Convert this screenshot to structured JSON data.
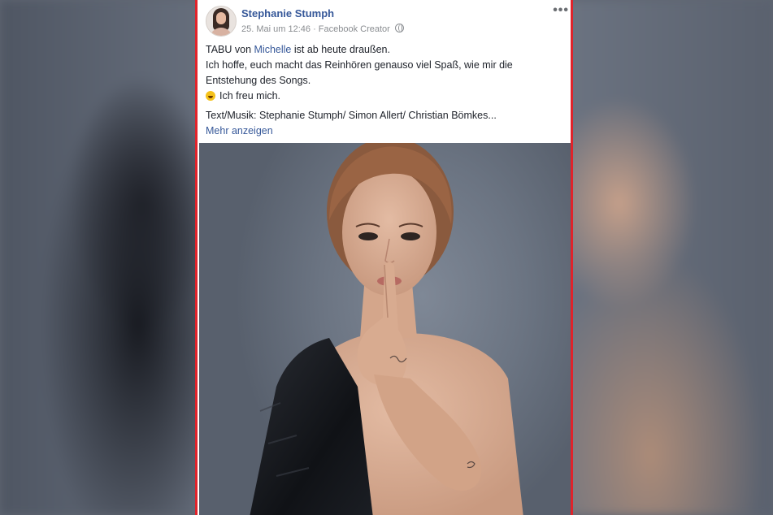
{
  "post": {
    "author": "Stephanie Stumph",
    "date": "25. Mai um 12:46",
    "separator": "·",
    "role": "Facebook Creator",
    "more_label": "•••",
    "text": {
      "line1_prefix": "TABU von ",
      "line1_link": "Michelle",
      "line1_suffix": " ist ab heute draußen.",
      "line2": "Ich hoffe, euch macht das Reinhören genauso viel Spaß, wie mir die",
      "line3": "Entstehung des Songs.",
      "line4": "Ich freu mich.",
      "line5": "Text/Musik: Stephanie Stumph/ Simon Allert/ Christian Bömkes...",
      "see_more": "Mehr anzeigen"
    },
    "photo_icon": "portrait-photo",
    "emoji_icon": "smiling-face-emoji",
    "colors": {
      "link": "#365899",
      "frame": "#e0232b",
      "text": "#1d2129",
      "meta": "#8a8d91"
    }
  }
}
